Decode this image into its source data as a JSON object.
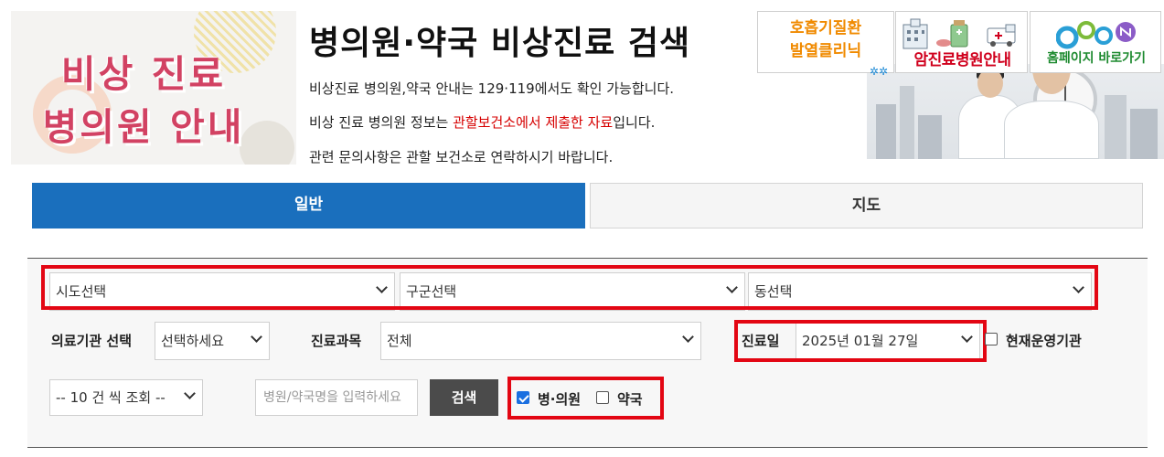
{
  "header": {
    "hero_line1": "비상 진료",
    "hero_line2": "병의원 안내",
    "title": "병의원·약국 비상진료 검색",
    "notice1": "비상진료 병의원,약국 안내는 129·119에서도 확인 가능합니다.",
    "notice2_pre": "비상 진료 병의원 정보는 ",
    "notice2_highlight": "관할보건소에서 제출한 자료",
    "notice2_post": "입니다.",
    "notice3": "관련 문의사항은 관할 보건소로 연락하시기 바랍니다."
  },
  "quick_links": {
    "respiratory_line1": "호흡기질환",
    "respiratory_line2": "발열클리닉",
    "cancer": "암진료병원안내",
    "homepage": "홈페이지 바로가기"
  },
  "tabs": [
    {
      "label": "일반",
      "active": true
    },
    {
      "label": "지도",
      "active": false
    }
  ],
  "search": {
    "sido": "시도선택",
    "gugun": "구군선택",
    "dong": "동선택",
    "institution_label": "의료기관 선택",
    "institution_value": "선택하세요",
    "department_label": "진료과목",
    "department_value": "전체",
    "date_label": "진료일",
    "date_value": "2025년 01월 27일",
    "open_now_label": "현재운영기관",
    "open_now_checked": false,
    "page_size": "-- 10 건 씩 조회 --",
    "name_placeholder": "병원/약국명을 입력하세요",
    "search_button": "검색",
    "hospital_label": "병·의원",
    "hospital_checked": true,
    "pharmacy_label": "약국",
    "pharmacy_checked": false
  },
  "colors": {
    "accent_blue": "#1a6fbd",
    "highlight_red": "#e30613",
    "hero_pink": "#d24263"
  }
}
